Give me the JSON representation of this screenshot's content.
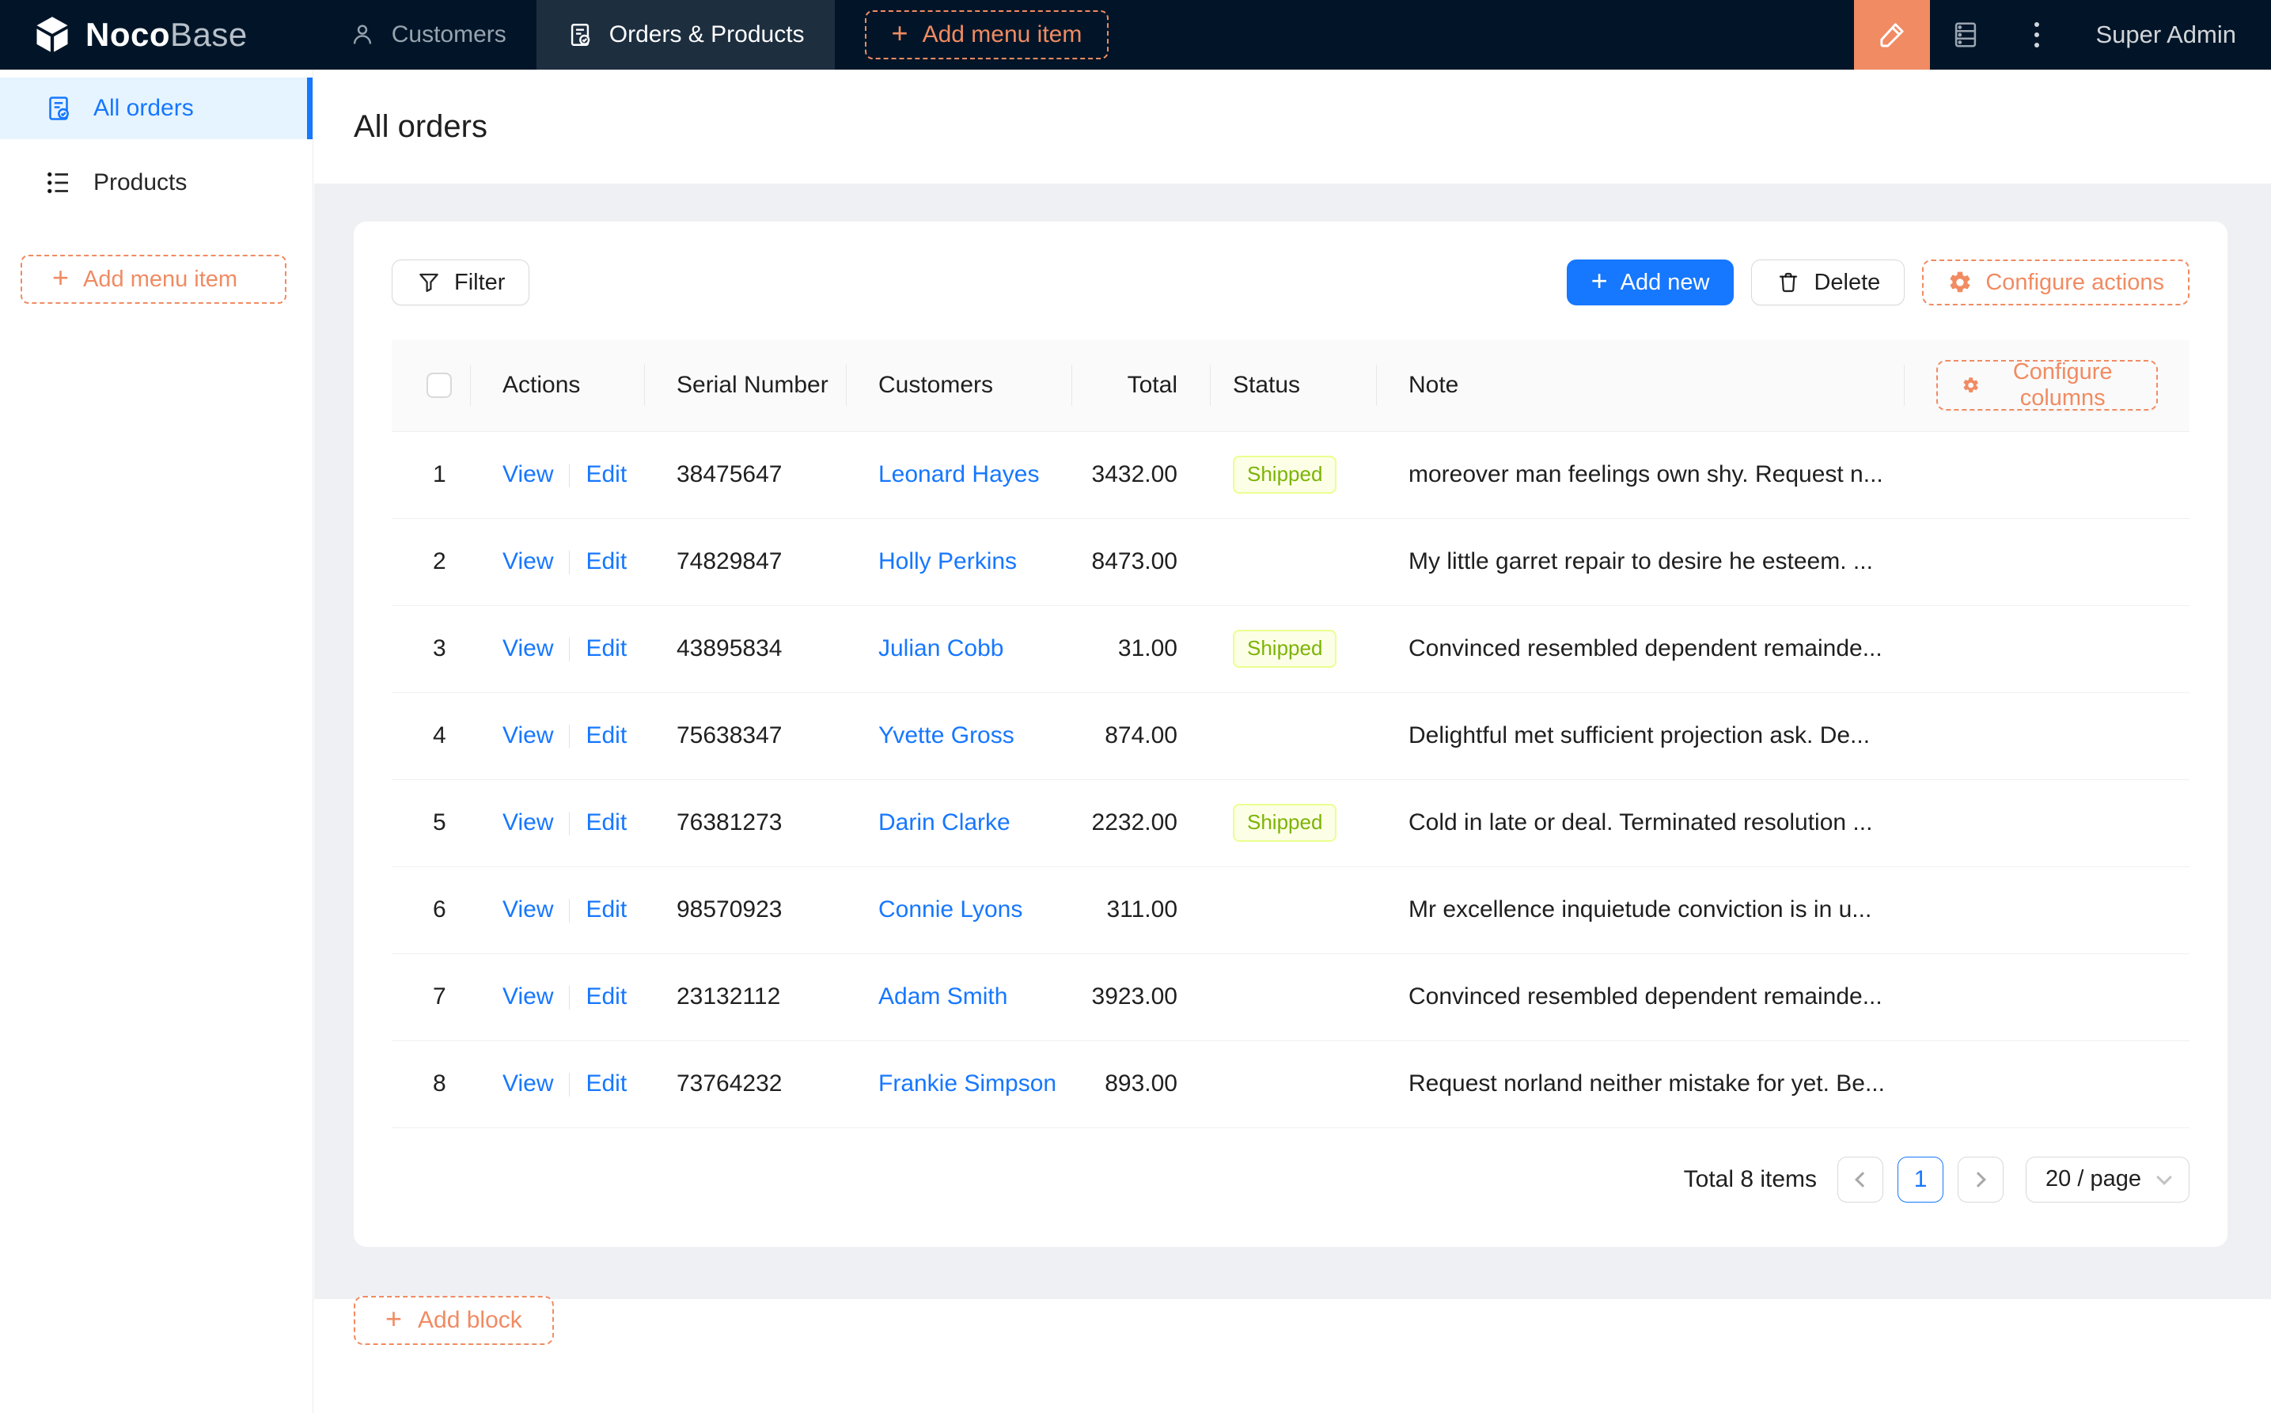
{
  "brand": {
    "name_bold": "Noco",
    "name_light": "Base"
  },
  "navbar": {
    "tabs": [
      {
        "label": "Customers",
        "icon": "user-icon",
        "active": false
      },
      {
        "label": "Orders & Products",
        "icon": "document-check-icon",
        "active": true
      }
    ],
    "add_menu_item_label": "Add menu item",
    "user_label": "Super Admin",
    "icons": [
      "highlighter-icon",
      "database-icon",
      "ellipsis-vertical-icon"
    ]
  },
  "sidebar": {
    "items": [
      {
        "label": "All orders",
        "icon": "document-check-icon",
        "active": true
      },
      {
        "label": "Products",
        "icon": "list-icon",
        "active": false
      }
    ],
    "add_menu_item_label": "Add menu item"
  },
  "page": {
    "title": "All orders"
  },
  "toolbar": {
    "filter_label": "Filter",
    "add_new_label": "Add new",
    "delete_label": "Delete",
    "configure_actions_label": "Configure actions"
  },
  "table": {
    "configure_columns_label": "Configure columns",
    "columns": [
      "",
      "Actions",
      "Serial Number",
      "Customers",
      "Total",
      "Status",
      "Note"
    ],
    "action_labels": [
      "View",
      "Edit"
    ],
    "rows": [
      {
        "index": "1",
        "serial": "38475647",
        "customer": "Leonard Hayes",
        "total": "3432.00",
        "status": "Shipped",
        "note": "moreover man feelings own shy. Request n..."
      },
      {
        "index": "2",
        "serial": "74829847",
        "customer": "Holly Perkins",
        "total": "8473.00",
        "status": "",
        "note": "My little garret repair to desire he esteem. ..."
      },
      {
        "index": "3",
        "serial": "43895834",
        "customer": "Julian Cobb",
        "total": "31.00",
        "status": "Shipped",
        "note": "Convinced resembled dependent remainde..."
      },
      {
        "index": "4",
        "serial": "75638347",
        "customer": "Yvette Gross",
        "total": "874.00",
        "status": "",
        "note": "Delightful met sufficient projection ask. De..."
      },
      {
        "index": "5",
        "serial": "76381273",
        "customer": "Darin Clarke",
        "total": "2232.00",
        "status": "Shipped",
        "note": "Cold in late or deal. Terminated resolution ..."
      },
      {
        "index": "6",
        "serial": "98570923",
        "customer": "Connie Lyons",
        "total": "311.00",
        "status": "",
        "note": "Mr excellence inquietude conviction is in u..."
      },
      {
        "index": "7",
        "serial": "23132112",
        "customer": "Adam Smith",
        "total": "3923.00",
        "status": "",
        "note": "Convinced resembled dependent remainde..."
      },
      {
        "index": "8",
        "serial": "73764232",
        "customer": "Frankie Simpson",
        "total": "893.00",
        "status": "",
        "note": "Request norland neither mistake for yet. Be..."
      }
    ]
  },
  "pagination": {
    "total_text": "Total 8 items",
    "current_page": "1",
    "page_size_label": "20 / page"
  },
  "footer": {
    "add_block_label": "Add block"
  },
  "colors": {
    "navbar_bg": "#021528",
    "accent_orange": "#f18b62",
    "primary_blue": "#1677ff",
    "sidebar_active_bg": "#e6f4ff",
    "status_tag_bg": "#fcffe6",
    "status_tag_border": "#eaff8f",
    "status_tag_text": "#7cb305"
  }
}
